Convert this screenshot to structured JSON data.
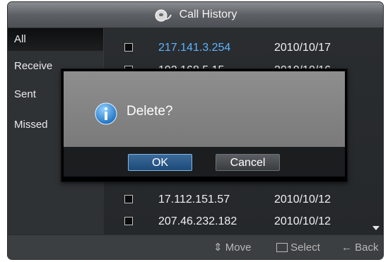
{
  "window": {
    "title": "Call History"
  },
  "sidebar": {
    "items": [
      {
        "label": "All"
      },
      {
        "label": "Receive"
      },
      {
        "label": "Sent"
      },
      {
        "label": "Missed"
      }
    ]
  },
  "list": {
    "rows": [
      {
        "ip": "217.141.3.254",
        "date": "2010/10/17"
      },
      {
        "ip": "192.168.5.15",
        "date": "2010/10/16"
      },
      {
        "ip": "17.112.151.57",
        "date": "2010/10/12"
      },
      {
        "ip": "207.46.232.182",
        "date": "2010/10/12"
      }
    ]
  },
  "dialog": {
    "message": "Delete?",
    "ok_label": "OK",
    "cancel_label": "Cancel"
  },
  "footer": {
    "move_label": "Move",
    "select_label": "Select",
    "back_label": "Back"
  },
  "icons": {
    "title": "phone-handset-icon",
    "info": "info-icon",
    "move": "updown-arrows-icon",
    "select": "enter-icon",
    "back": "left-arrow-icon",
    "scroll": "scroll-down-arrow-icon"
  },
  "colors": {
    "highlight_ip": "#5ab4ff",
    "ok_button": "#2a5a8a"
  }
}
